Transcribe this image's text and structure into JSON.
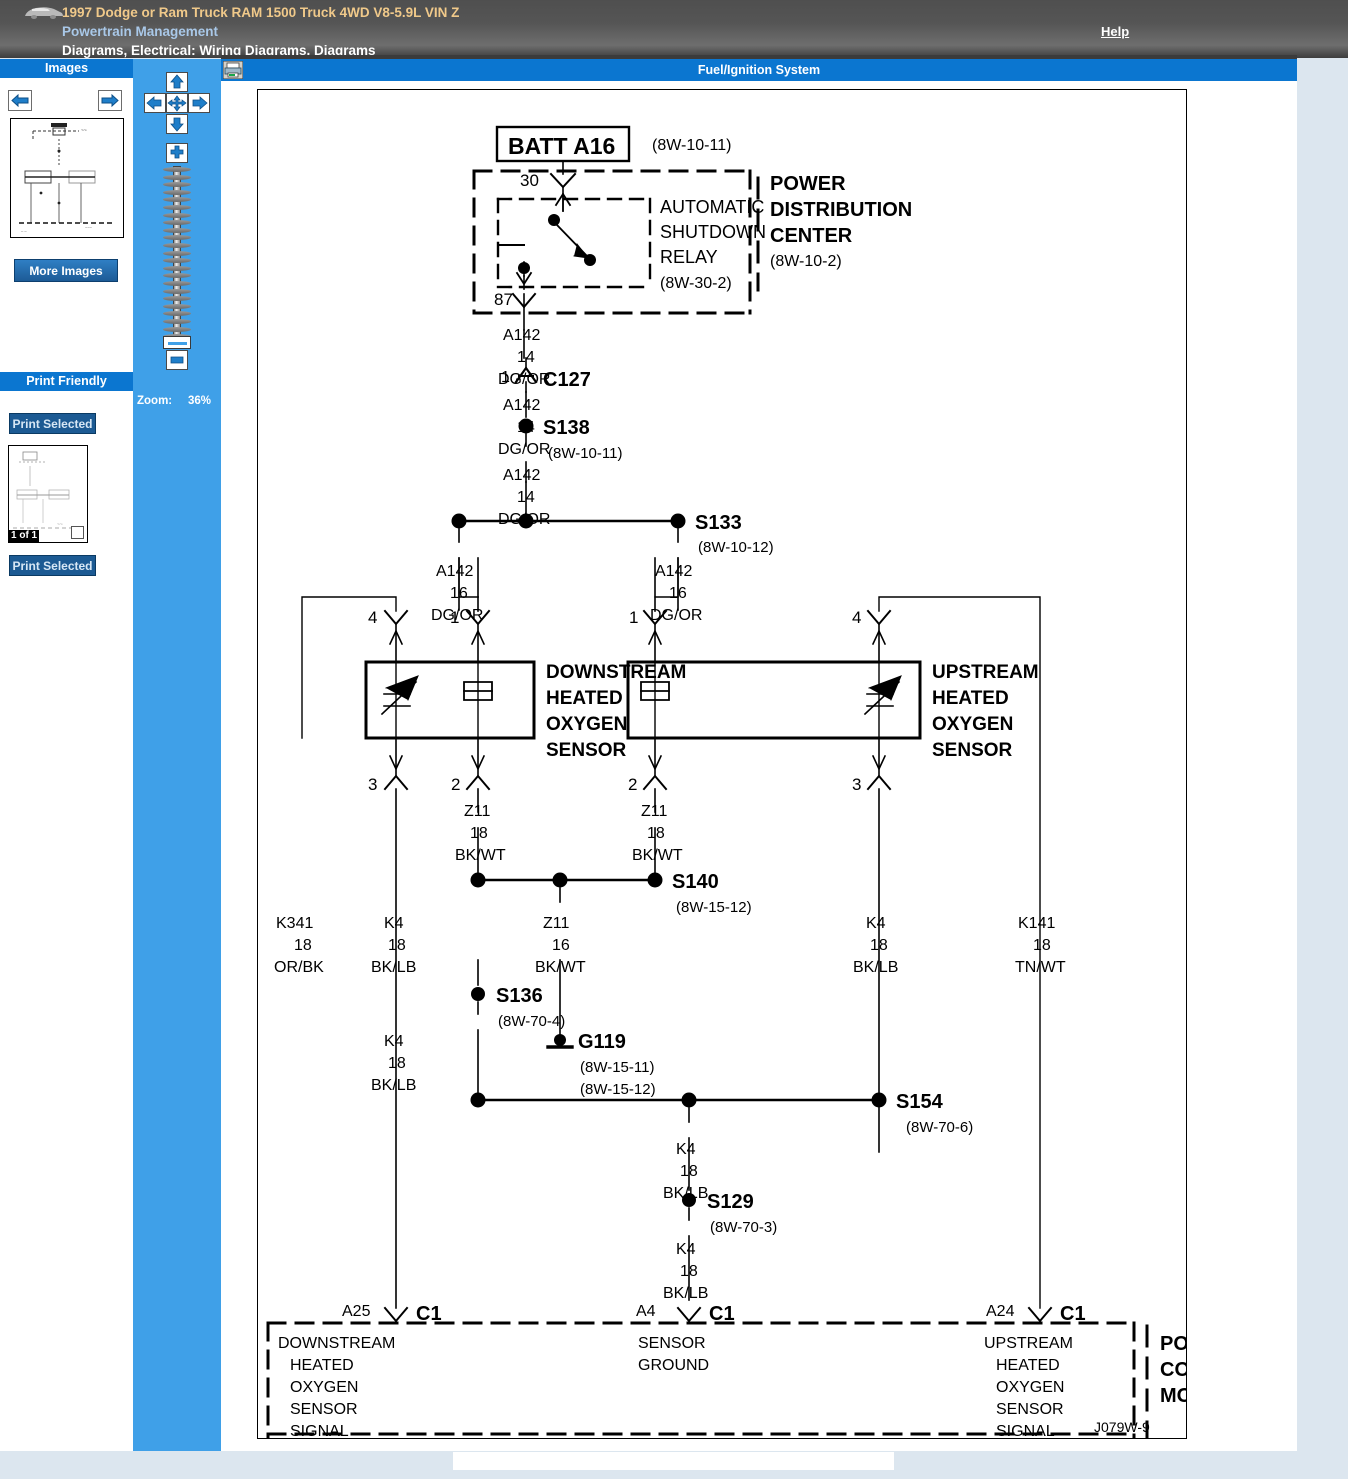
{
  "header": {
    "vehicle_title": "1997 Dodge or Ram Truck RAM 1500 Truck 4WD V8-5.9L VIN Z",
    "section": "Powertrain Management",
    "breadcrumb": "Diagrams, Electrical: Wiring Diagrams, Diagrams",
    "help_label": "Help",
    "car_icon": "car-icon"
  },
  "sidebar": {
    "images_header": "Images",
    "prev_icon": "left-arrow-icon",
    "next_icon": "right-arrow-icon",
    "more_images_label": "More Images",
    "print_friendly_header": "Print Friendly",
    "print_selected_top_label": "Print Selected",
    "print_selected_bottom_label": "Print Selected",
    "page_count_label": "1 of 1"
  },
  "tools": {
    "pan_up_icon": "up-arrow-icon",
    "pan_down_icon": "down-arrow-icon",
    "pan_left_icon": "left-arrow-icon",
    "pan_right_icon": "right-arrow-icon",
    "pan_center_icon": "move-icon",
    "zoom_in_icon": "plus-icon",
    "zoom_out_icon": "minus-icon",
    "zoom_label": "Zoom:",
    "zoom_value": "36%"
  },
  "viewer": {
    "title": "Fuel/Ignition System",
    "printer_icon": "printer-icon"
  },
  "diagram": {
    "corner_code": "J079W-9",
    "blocks": [
      {
        "id": "batt",
        "label": "BATT A16",
        "ref": "(8W-10-11)"
      },
      {
        "id": "asd-relay",
        "label": "AUTOMATIC SHUTDOWN RELAY",
        "ref": "(8W-30-2)",
        "lines": [
          "AUTOMATIC",
          "SHUTDOWN",
          "RELAY"
        ],
        "pins": [
          "30",
          "87"
        ]
      },
      {
        "id": "pdc",
        "label": "POWER DISTRIBUTION CENTER",
        "ref": "(8W-10-2)",
        "lines": [
          "POWER",
          "DISTRIBUTION",
          "CENTER"
        ]
      },
      {
        "id": "downstream-o2",
        "label": "DOWNSTREAM HEATED OXYGEN SENSOR",
        "lines": [
          "DOWNSTREAM",
          "HEATED",
          "OXYGEN",
          "SENSOR"
        ],
        "pins": [
          "4",
          "1",
          "3",
          "2"
        ]
      },
      {
        "id": "upstream-o2",
        "label": "UPSTREAM HEATED OXYGEN SENSOR",
        "lines": [
          "UPSTREAM",
          "HEATED",
          "OXYGEN",
          "SENSOR"
        ],
        "pins": [
          "1",
          "4",
          "2",
          "3"
        ]
      },
      {
        "id": "pcm",
        "label": "POWERTRAIN CONTROL MODULE",
        "lines": [
          "POWERTRAIN",
          "CONTROL",
          "MODULE"
        ]
      }
    ],
    "pcm_pins": [
      {
        "pin": "A25",
        "conn": "C1",
        "lines": [
          "DOWNSTREAM",
          "HEATED",
          "OXYGEN",
          "SENSOR",
          "SIGNAL"
        ]
      },
      {
        "pin": "A4",
        "conn": "C1",
        "lines": [
          "SENSOR",
          "GROUND"
        ]
      },
      {
        "pin": "A24",
        "conn": "C1",
        "lines": [
          "UPSTREAM",
          "HEATED",
          "OXYGEN",
          "SENSOR",
          "SIGNAL"
        ]
      }
    ],
    "connectors": [
      {
        "id": "C127",
        "pin": "1",
        "label": "C127"
      }
    ],
    "splices": [
      {
        "id": "S138",
        "label": "S138",
        "ref": "(8W-10-11)"
      },
      {
        "id": "S133",
        "label": "S133",
        "ref": "(8W-10-12)"
      },
      {
        "id": "S140",
        "label": "S140",
        "ref": "(8W-15-12)"
      },
      {
        "id": "S136",
        "label": "S136",
        "ref": "(8W-70-4)"
      },
      {
        "id": "S154",
        "label": "S154",
        "ref": "(8W-70-6)"
      },
      {
        "id": "S129",
        "label": "S129",
        "ref": "(8W-70-3)"
      }
    ],
    "grounds": [
      {
        "id": "G119",
        "label": "G119",
        "ref1": "(8W-15-11)",
        "ref2": "(8W-15-12)"
      }
    ],
    "wires": [
      {
        "id": "w1",
        "circuit": "A142",
        "gauge": "14",
        "color": "DG/OR"
      },
      {
        "id": "w2",
        "circuit": "A142",
        "gauge": "14",
        "color": "DG/OR"
      },
      {
        "id": "w3",
        "circuit": "A142",
        "gauge": "14",
        "color": "DG/OR"
      },
      {
        "id": "w4",
        "circuit": "A142",
        "gauge": "16",
        "color": "DG/OR"
      },
      {
        "id": "w5",
        "circuit": "A142",
        "gauge": "16",
        "color": "DG/OR"
      },
      {
        "id": "w6",
        "circuit": "Z11",
        "gauge": "18",
        "color": "BK/WT"
      },
      {
        "id": "w7",
        "circuit": "Z11",
        "gauge": "18",
        "color": "BK/WT"
      },
      {
        "id": "w8",
        "circuit": "K341",
        "gauge": "18",
        "color": "OR/BK"
      },
      {
        "id": "w9",
        "circuit": "K4",
        "gauge": "18",
        "color": "BK/LB"
      },
      {
        "id": "w10",
        "circuit": "Z11",
        "gauge": "16",
        "color": "BK/WT"
      },
      {
        "id": "w11",
        "circuit": "K4",
        "gauge": "18",
        "color": "BK/LB"
      },
      {
        "id": "w12",
        "circuit": "K141",
        "gauge": "18",
        "color": "TN/WT"
      },
      {
        "id": "w13",
        "circuit": "K4",
        "gauge": "18",
        "color": "BK/LB"
      },
      {
        "id": "w14",
        "circuit": "K4",
        "gauge": "18",
        "color": "BK/LB"
      },
      {
        "id": "w15",
        "circuit": "K4",
        "gauge": "18",
        "color": "BK/LB"
      }
    ]
  },
  "colors": {
    "brand_blue": "#0b76d0",
    "tool_blue": "#3fa0e8",
    "page_bg": "#dce6ef",
    "header_gray": "#5a5a5a",
    "title_gold": "#f0c98a"
  }
}
